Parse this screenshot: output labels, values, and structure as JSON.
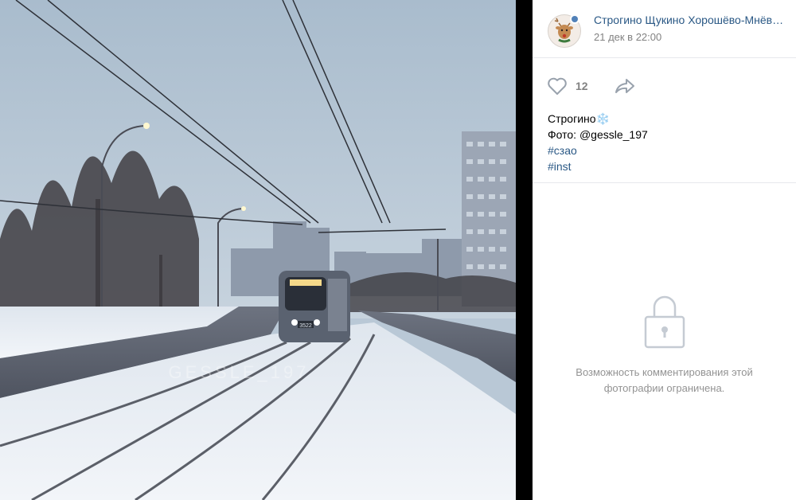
{
  "author": {
    "name": "Строгино Щукино Хорошёво-Мнёв…",
    "date": "21 дек в 22:00",
    "avatar_icon": "deer-avatar-icon",
    "verified_icon": "verified-badge-icon"
  },
  "actions": {
    "like_count": "12",
    "like_icon": "heart-outline-icon",
    "share_icon": "share-arrow-icon"
  },
  "post": {
    "place": "Строгино",
    "emoji": "❄️",
    "photo_credit": "Фото: @gessle_197",
    "hashtags": [
      "#сзао",
      "#inst"
    ]
  },
  "photo": {
    "watermark": "GESSLE_197",
    "tram_number": "3522"
  },
  "comments": {
    "locked_icon": "lock-icon",
    "message_line1": "Возможность комментирования этой",
    "message_line2": "фотографии ограничена."
  },
  "colors": {
    "link": "#2a5885",
    "muted": "#828282",
    "divider": "#000000",
    "sky": "#b9c8d6"
  }
}
